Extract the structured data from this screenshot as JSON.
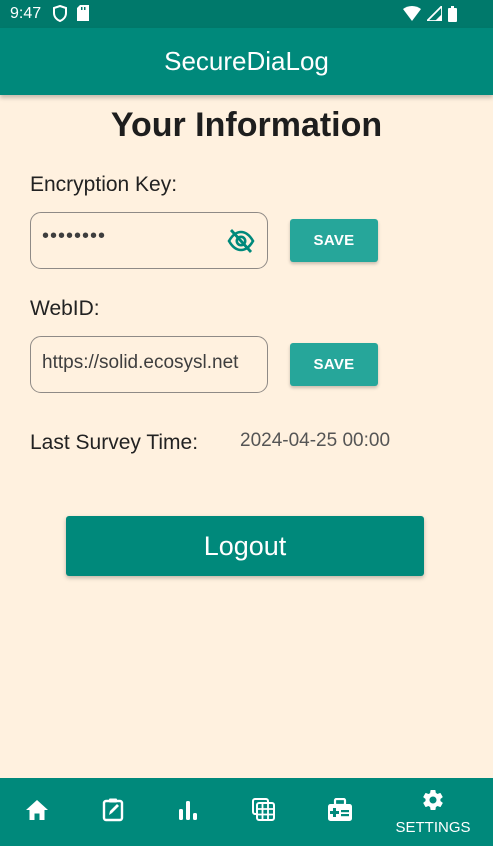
{
  "status_bar": {
    "time": "9:47",
    "left_icons": [
      "shield-icon",
      "sd-card-icon"
    ],
    "right_icons": [
      "wifi-icon",
      "signal-icon",
      "battery-icon"
    ]
  },
  "app_bar": {
    "title": "SecureDiaLog"
  },
  "page": {
    "title": "Your Information"
  },
  "encryption": {
    "label": "Encryption Key:",
    "masked_value": "••••••••",
    "visibility_icon": "visibility-off-icon",
    "save_label": "SAVE"
  },
  "webid": {
    "label": "WebID:",
    "value": "https://solid.ecosysl.net",
    "save_label": "SAVE"
  },
  "survey": {
    "label": "Last Survey Time:",
    "value": "2024-04-25 00:00"
  },
  "logout": {
    "label": "Logout"
  },
  "bottom_nav": {
    "items": [
      {
        "icon": "home-icon",
        "label": ""
      },
      {
        "icon": "edit-note-icon",
        "label": ""
      },
      {
        "icon": "bar-chart-icon",
        "label": ""
      },
      {
        "icon": "calendar-grid-icon",
        "label": ""
      },
      {
        "icon": "medical-kit-icon",
        "label": ""
      },
      {
        "icon": "gear-icon",
        "label": "SETTINGS"
      }
    ]
  },
  "colors": {
    "primary": "#00897B",
    "primary_dark": "#00796B",
    "button": "#26A69A",
    "background": "#FFF1DF"
  }
}
